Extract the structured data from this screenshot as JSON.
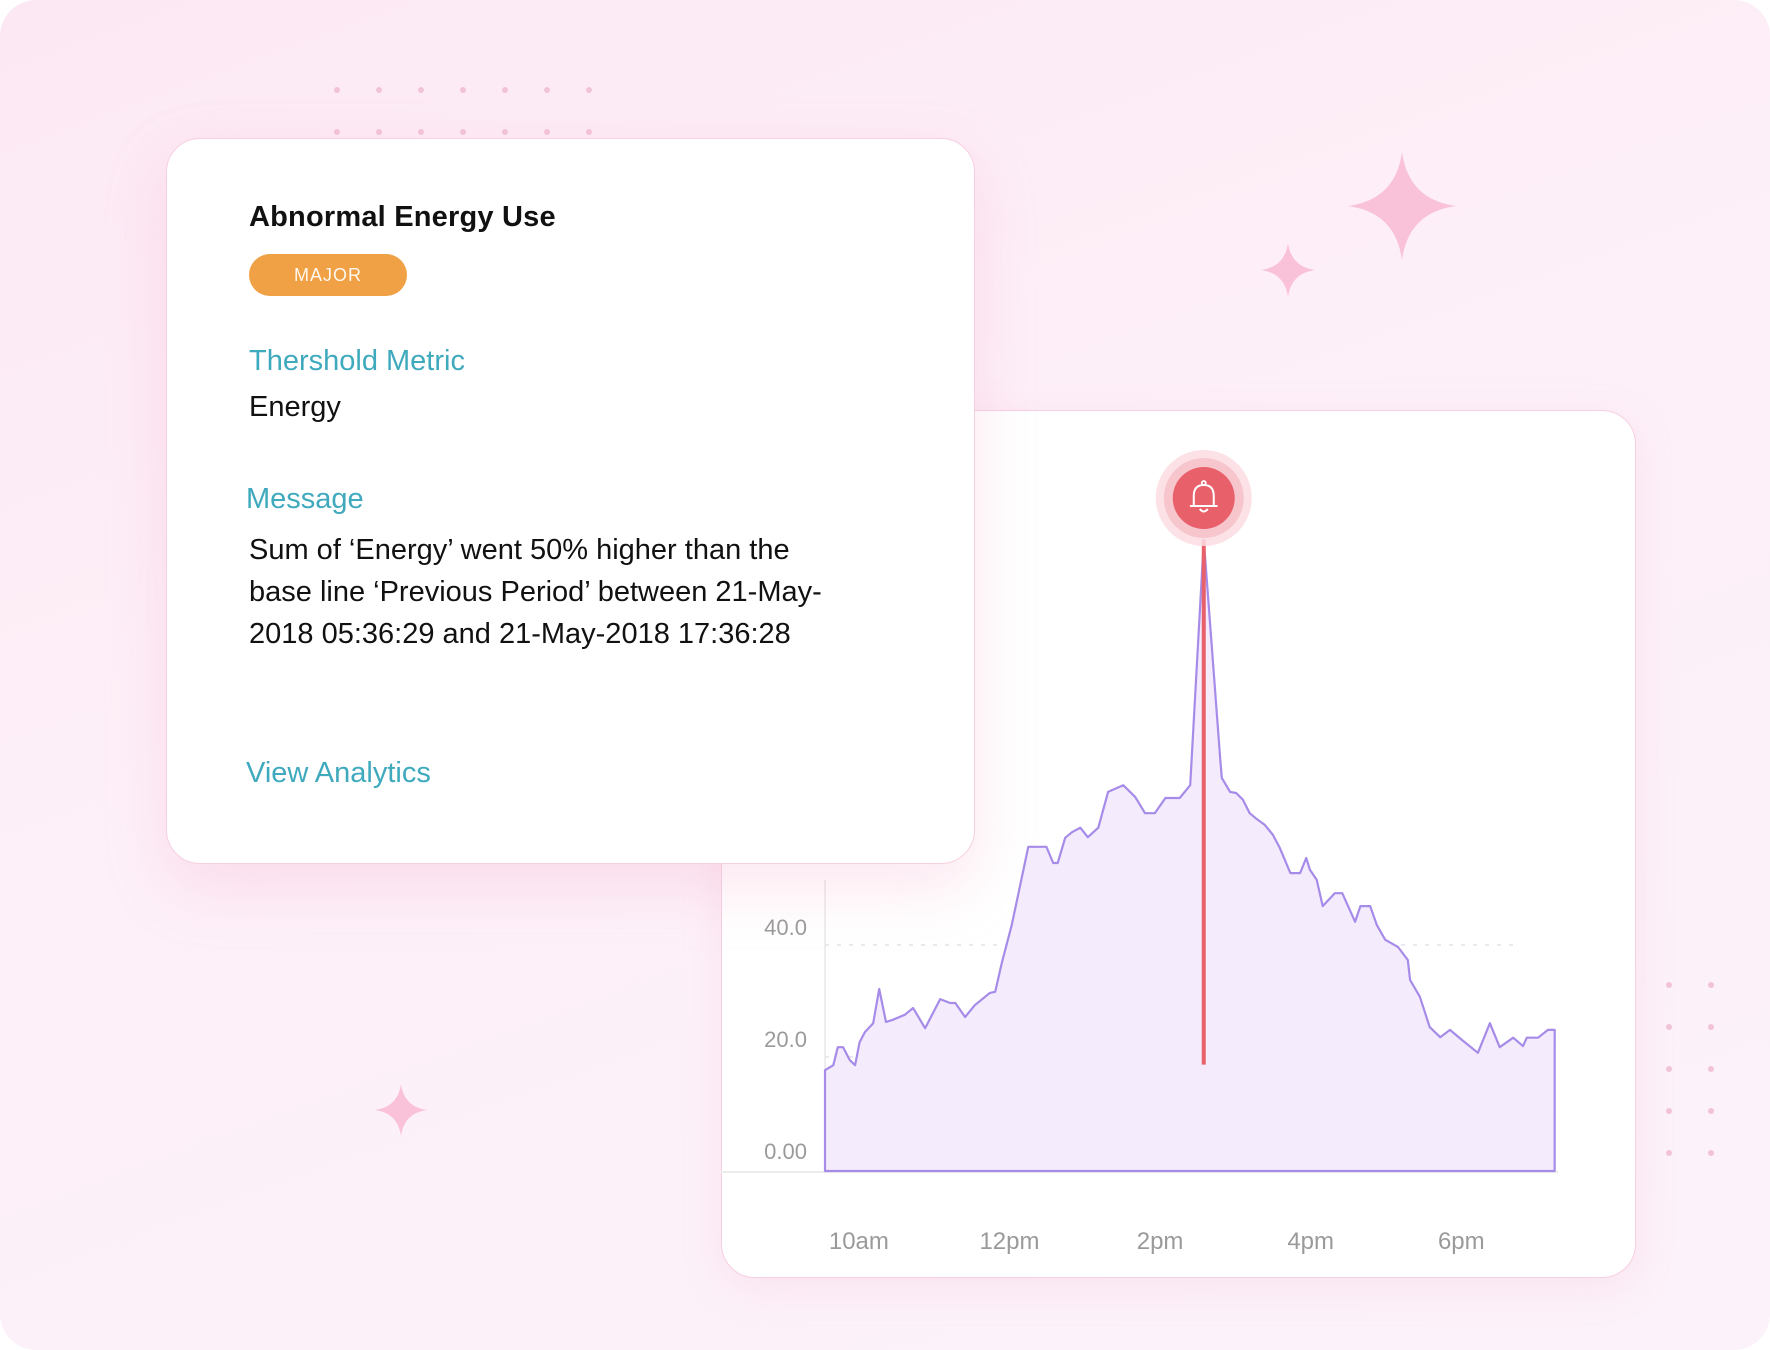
{
  "alert": {
    "title": "Abnormal Energy Use",
    "severity": "MAJOR",
    "severity_color": "#f0a045",
    "metric_label": "Thershold Metric",
    "metric_value": "Energy",
    "message_label": "Message",
    "message": "Sum of ‘Energy’ went  50% higher than the base line ‘Previous Period’ between 21-May-2018 05:36:29 and 21-May-2018 17:36:28",
    "view_link": "View Analytics",
    "accent_color": "#3fa9bd"
  },
  "chart_data": {
    "type": "area",
    "title": "",
    "xlabel": "",
    "ylabel": "",
    "x_unit": "hour of day",
    "x_ticks": [
      {
        "value": 10,
        "label": "10am"
      },
      {
        "value": 12,
        "label": "12pm"
      },
      {
        "value": 14,
        "label": "2pm"
      },
      {
        "value": 16,
        "label": "4pm"
      },
      {
        "value": 18,
        "label": "6pm"
      }
    ],
    "y_ticks": [
      {
        "value": 0,
        "label": "0.00"
      },
      {
        "value": 20,
        "label": "20.0"
      },
      {
        "value": 40,
        "label": "40.0"
      }
    ],
    "xlim": [
      9.55,
      19.24
    ],
    "ylim": [
      0,
      113
    ],
    "grid": true,
    "series": [
      {
        "name": "Energy",
        "color": "#a68be8",
        "fill": "#f4ecfd",
        "points": [
          [
            9.55,
            18.0
          ],
          [
            9.66,
            18.9
          ],
          [
            9.72,
            22.1
          ],
          [
            9.79,
            22.1
          ],
          [
            9.88,
            19.8
          ],
          [
            9.95,
            18.9
          ],
          [
            10.01,
            23.0
          ],
          [
            10.08,
            24.8
          ],
          [
            10.19,
            26.4
          ],
          [
            10.27,
            32.5
          ],
          [
            10.36,
            26.6
          ],
          [
            10.45,
            27.0
          ],
          [
            10.61,
            27.9
          ],
          [
            10.72,
            29.1
          ],
          [
            10.88,
            25.5
          ],
          [
            11.08,
            30.7
          ],
          [
            11.21,
            30.0
          ],
          [
            11.28,
            30.0
          ],
          [
            11.41,
            27.5
          ],
          [
            11.54,
            29.6
          ],
          [
            11.74,
            31.8
          ],
          [
            11.81,
            32.0
          ],
          [
            11.9,
            37.3
          ],
          [
            12.03,
            43.9
          ],
          [
            12.25,
            57.9
          ],
          [
            12.49,
            57.9
          ],
          [
            12.58,
            55.0
          ],
          [
            12.64,
            55.0
          ],
          [
            12.74,
            59.5
          ],
          [
            12.83,
            60.5
          ],
          [
            12.94,
            61.3
          ],
          [
            13.04,
            59.6
          ],
          [
            13.18,
            61.3
          ],
          [
            13.31,
            67.7
          ],
          [
            13.51,
            68.9
          ],
          [
            13.67,
            66.8
          ],
          [
            13.8,
            63.9
          ],
          [
            13.93,
            63.9
          ],
          [
            14.07,
            66.6
          ],
          [
            14.26,
            66.6
          ],
          [
            14.4,
            68.9
          ],
          [
            14.58,
            112.7
          ],
          [
            14.8,
            73.4
          ],
          [
            14.82,
            70.2
          ],
          [
            14.93,
            67.7
          ],
          [
            15.01,
            67.5
          ],
          [
            15.1,
            66.3
          ],
          [
            15.19,
            63.9
          ],
          [
            15.27,
            63.0
          ],
          [
            15.39,
            61.8
          ],
          [
            15.5,
            60.0
          ],
          [
            15.59,
            57.7
          ],
          [
            15.73,
            53.2
          ],
          [
            15.86,
            53.2
          ],
          [
            15.94,
            55.9
          ],
          [
            15.99,
            53.8
          ],
          [
            16.08,
            52.0
          ],
          [
            16.16,
            47.3
          ],
          [
            16.32,
            49.6
          ],
          [
            16.42,
            49.6
          ],
          [
            16.59,
            44.5
          ],
          [
            16.66,
            47.3
          ],
          [
            16.79,
            47.3
          ],
          [
            16.88,
            43.9
          ],
          [
            16.99,
            41.3
          ],
          [
            17.16,
            40.0
          ],
          [
            17.29,
            37.7
          ],
          [
            17.32,
            34.1
          ],
          [
            17.45,
            31.1
          ],
          [
            17.58,
            25.7
          ],
          [
            17.72,
            23.9
          ],
          [
            17.85,
            25.2
          ],
          [
            18.01,
            23.4
          ],
          [
            18.22,
            21.1
          ],
          [
            18.38,
            26.4
          ],
          [
            18.51,
            22.1
          ],
          [
            18.69,
            23.8
          ],
          [
            18.82,
            22.3
          ],
          [
            18.87,
            23.8
          ],
          [
            19.02,
            23.8
          ],
          [
            19.15,
            25.2
          ],
          [
            19.24,
            25.2
          ]
        ]
      }
    ],
    "alert_marker": {
      "x": 14.58,
      "y_from": 19,
      "y_to": 112.7,
      "color": "#e8606a",
      "icon": "bell-icon"
    }
  }
}
